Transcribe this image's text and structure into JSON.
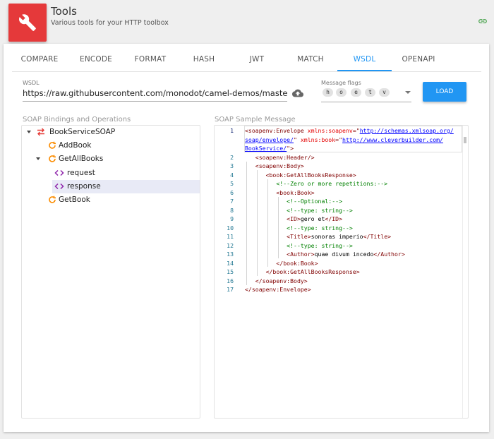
{
  "header": {
    "title": "Tools",
    "subtitle": "Various tools for your HTTP toolbox",
    "logo_icon": "wrench-icon",
    "link_icon": "link-icon",
    "brand_color": "#e5393a",
    "accent_color": "#2196f3"
  },
  "tabs": [
    {
      "label": "COMPARE",
      "active": false
    },
    {
      "label": "ENCODE",
      "active": false
    },
    {
      "label": "FORMAT",
      "active": false
    },
    {
      "label": "HASH",
      "active": false
    },
    {
      "label": "JWT",
      "active": false
    },
    {
      "label": "MATCH",
      "active": false
    },
    {
      "label": "WSDL",
      "active": true
    },
    {
      "label": "OPENAPI",
      "active": false
    }
  ],
  "wsdl": {
    "label": "WSDL",
    "value": "https://raw.githubusercontent.com/monodot/camel-demos/master/simple-tests/src/test/resources/BookService.wsdl",
    "upload_icon": "cloud-upload-icon"
  },
  "flags": {
    "label": "Message flags",
    "chips": [
      "h",
      "o",
      "e",
      "t",
      "v"
    ]
  },
  "load_label": "LOAD",
  "bindings": {
    "title": "SOAP Bindings and Operations",
    "items": [
      {
        "label": "BookServiceSOAP",
        "icon": "binding-icon",
        "expanded": true
      },
      {
        "label": "AddBook",
        "icon": "operation-icon"
      },
      {
        "label": "GetAllBooks",
        "icon": "operation-icon",
        "expanded": true
      },
      {
        "label": "request",
        "icon": "code-icon"
      },
      {
        "label": "response",
        "icon": "code-icon",
        "selected": true
      },
      {
        "label": "GetBook",
        "icon": "operation-icon"
      }
    ]
  },
  "sample": {
    "title": "SOAP Sample Message",
    "line_numbers": [
      "1",
      "2",
      "3",
      "4",
      "5",
      "6",
      "7",
      "8",
      "9",
      "10",
      "11",
      "12",
      "13",
      "14",
      "15",
      "16",
      "17"
    ]
  }
}
